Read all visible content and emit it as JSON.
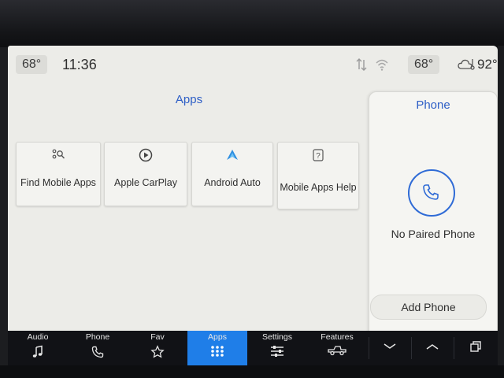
{
  "status_bar": {
    "cabin_temp": "68°",
    "time": "11:36",
    "passenger_temp": "68°",
    "outside_temp": "92°"
  },
  "apps": {
    "title": "Apps",
    "tiles": [
      {
        "label": "Find Mobile Apps",
        "icon": "find-apps-icon"
      },
      {
        "label": "Apple CarPlay",
        "icon": "play-circle-icon"
      },
      {
        "label": "Android Auto",
        "icon": "android-auto-icon"
      },
      {
        "label": "Mobile Apps Help",
        "icon": "help-icon"
      }
    ]
  },
  "phone": {
    "title": "Phone",
    "status": "No Paired Phone",
    "add_label": "Add Phone"
  },
  "nav": {
    "items": [
      {
        "label": "Audio",
        "icon": "music-note-icon"
      },
      {
        "label": "Phone",
        "icon": "phone-icon"
      },
      {
        "label": "Fav",
        "icon": "star-icon"
      },
      {
        "label": "Apps",
        "icon": "grid-icon",
        "active": true
      },
      {
        "label": "Settings",
        "icon": "sliders-icon"
      },
      {
        "label": "Features",
        "icon": "truck-icon"
      }
    ],
    "accent": "#1f7ee8"
  }
}
